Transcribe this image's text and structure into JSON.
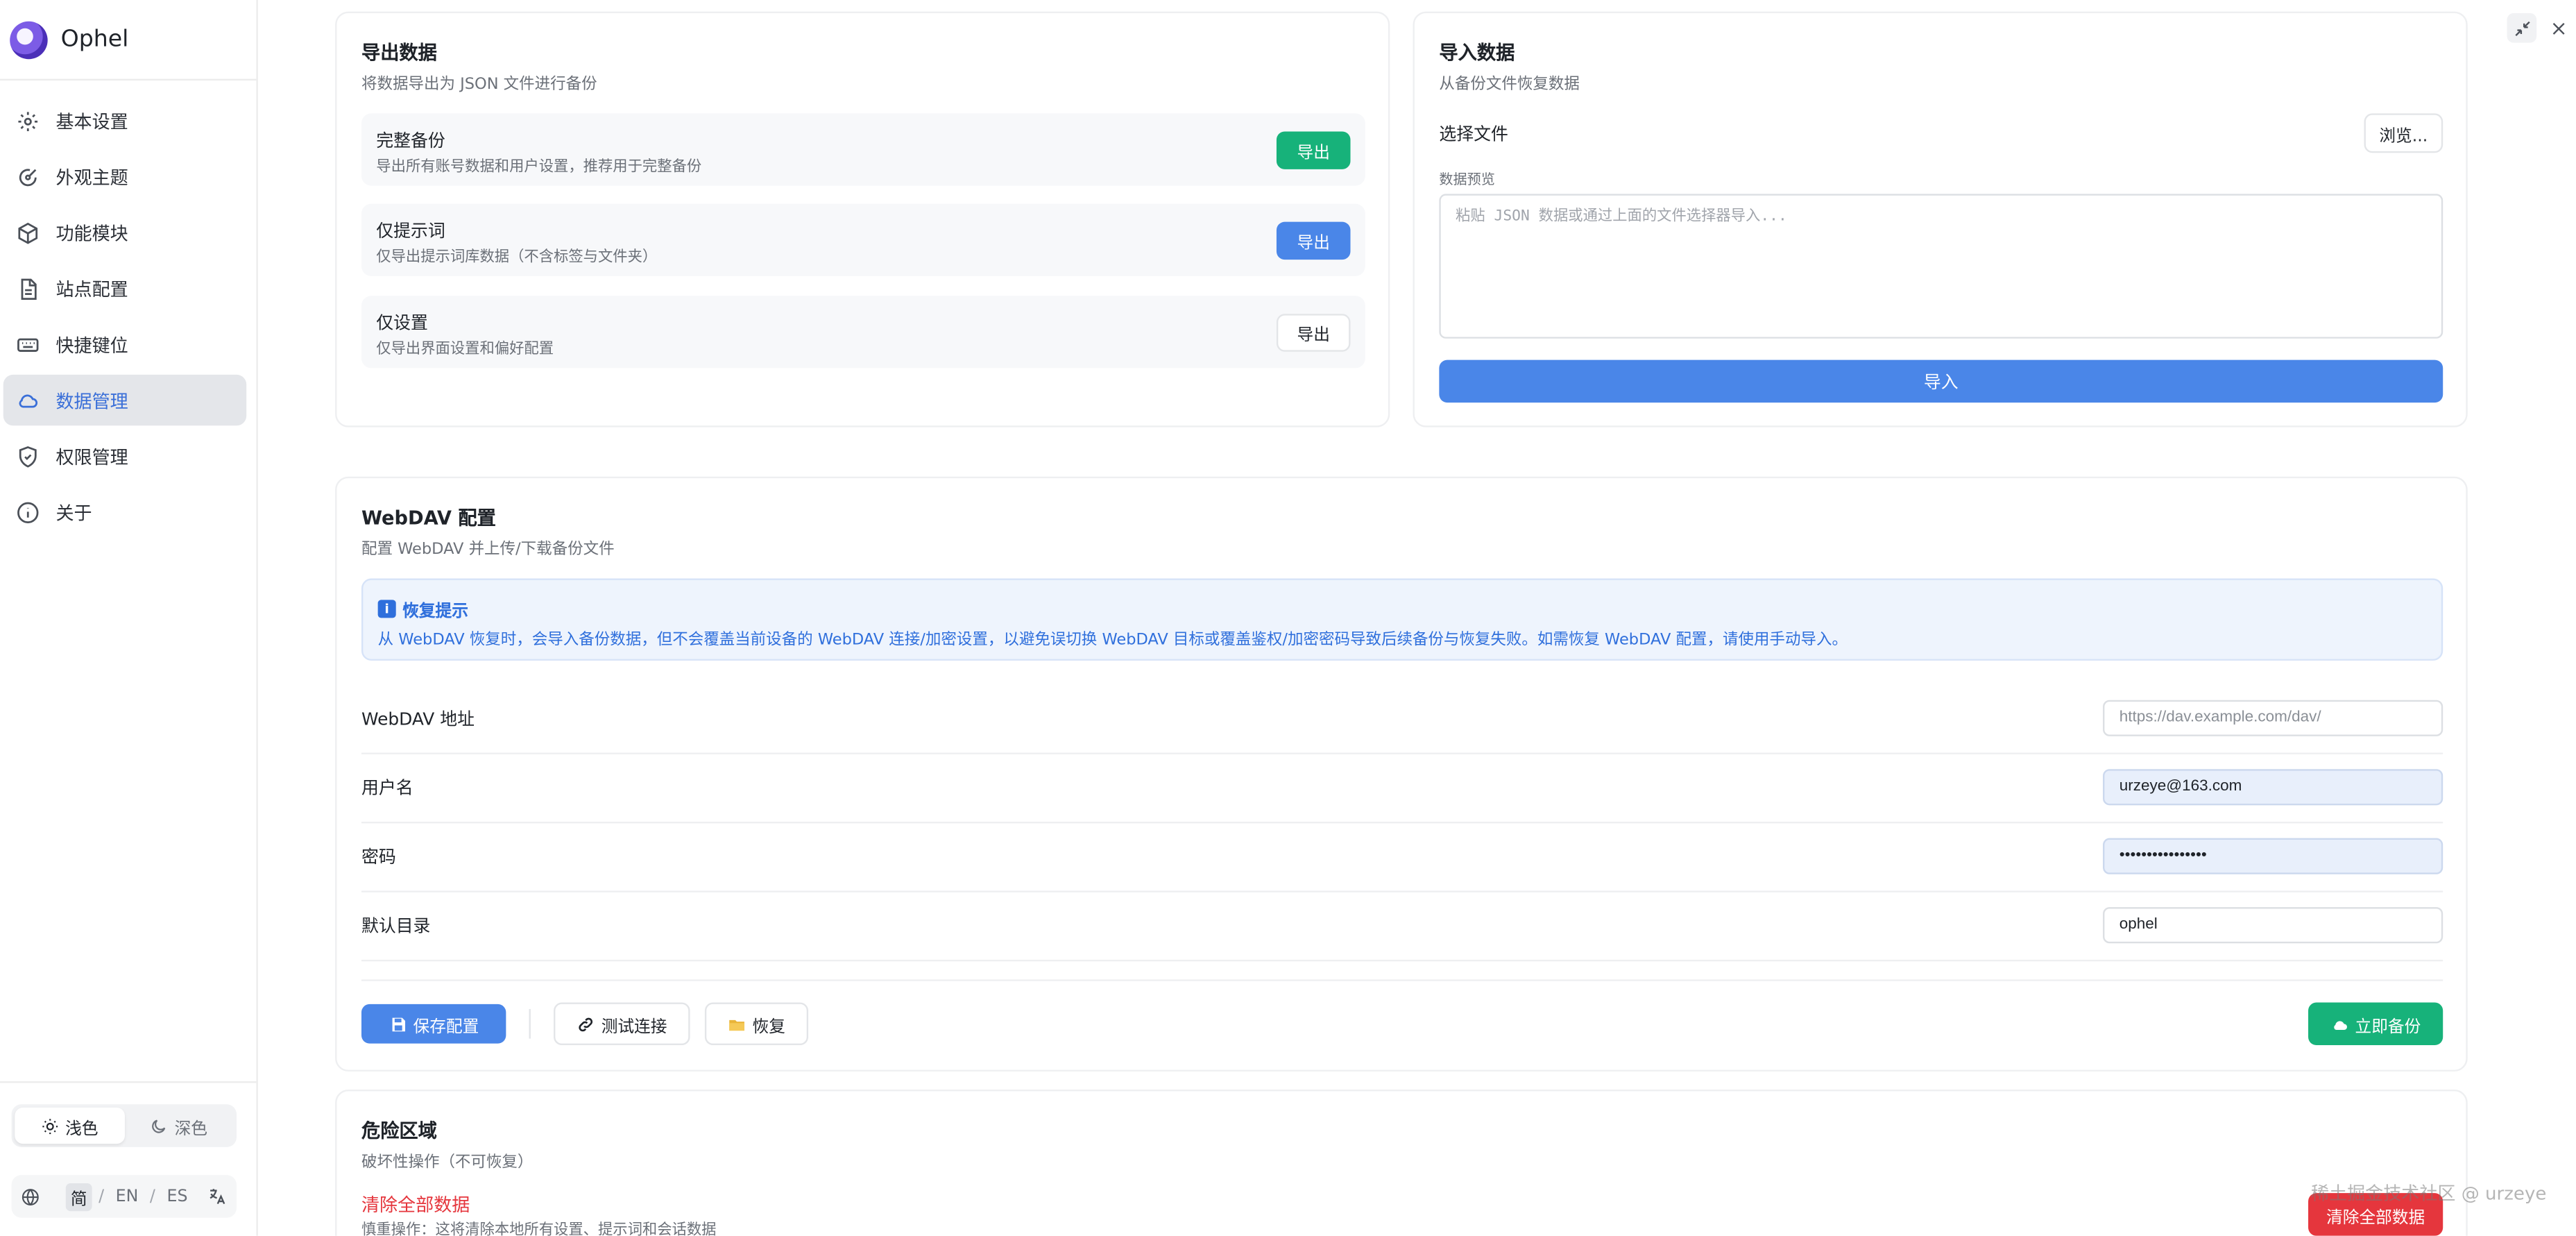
{
  "app": {
    "name": "Ophel"
  },
  "sidebar": {
    "items": [
      {
        "label": "基本设置",
        "icon": "gear-icon"
      },
      {
        "label": "外观主题",
        "icon": "palette-icon"
      },
      {
        "label": "功能模块",
        "icon": "box-icon"
      },
      {
        "label": "站点配置",
        "icon": "document-icon"
      },
      {
        "label": "快捷键位",
        "icon": "keyboard-icon"
      },
      {
        "label": "数据管理",
        "icon": "cloud-icon",
        "active": true
      },
      {
        "label": "权限管理",
        "icon": "shield-icon"
      },
      {
        "label": "关于",
        "icon": "info-icon"
      }
    ],
    "theme": {
      "light": "浅色",
      "dark": "深色",
      "selected": "light"
    },
    "languages": {
      "zh": "简",
      "en": "EN",
      "es": "ES",
      "selected": "zh"
    }
  },
  "export": {
    "title": "导出数据",
    "subtitle": "将数据导出为 JSON 文件进行备份",
    "rows": [
      {
        "title": "完整备份",
        "desc": "导出所有账号数据和用户设置，推荐用于完整备份",
        "button": "导出"
      },
      {
        "title": "仅提示词",
        "desc": "仅导出提示词库数据（不含标签与文件夹）",
        "button": "导出"
      },
      {
        "title": "仅设置",
        "desc": "仅导出界面设置和偏好配置",
        "button": "导出"
      }
    ]
  },
  "import": {
    "title": "导入数据",
    "subtitle": "从备份文件恢复数据",
    "file_label": "选择文件",
    "browse_button": "浏览...",
    "preview_label": "数据预览",
    "preview_placeholder": "粘贴 JSON 数据或通过上面的文件选择器导入...",
    "import_button": "导入"
  },
  "webdav": {
    "title": "WebDAV 配置",
    "subtitle": "配置 WebDAV 并上传/下载备份文件",
    "notice_title": "恢复提示",
    "notice_text": "从 WebDAV 恢复时，会导入备份数据，但不会覆盖当前设备的 WebDAV 连接/加密设置，以避免误切换 WebDAV 目标或覆盖鉴权/加密密码导致后续备份与恢复失败。如需恢复 WebDAV 配置，请使用手动导入。",
    "url_label": "WebDAV 地址",
    "url_placeholder": "https://dav.example.com/dav/",
    "username_label": "用户名",
    "username_value": "urzeye@163.com",
    "password_label": "密码",
    "password_value": "••••••••••••••••",
    "dir_label": "默认目录",
    "dir_value": "ophel",
    "save_button": "保存配置",
    "test_button": "测试连接",
    "restore_button": "恢复",
    "backup_button": "立即备份"
  },
  "danger": {
    "title": "危险区域",
    "subtitle": "破坏性操作（不可恢复）",
    "clear_title": "清除全部数据",
    "clear_desc": "慎重操作：这将清除本地所有设置、提示词和会话数据",
    "clear_button": "清除全部数据"
  },
  "watermark": "稀土掘金技术社区 @ urzeye",
  "colors": {
    "accent_blue": "#4a86e8",
    "green": "#17b27a",
    "danger_red": "#e5363d"
  }
}
